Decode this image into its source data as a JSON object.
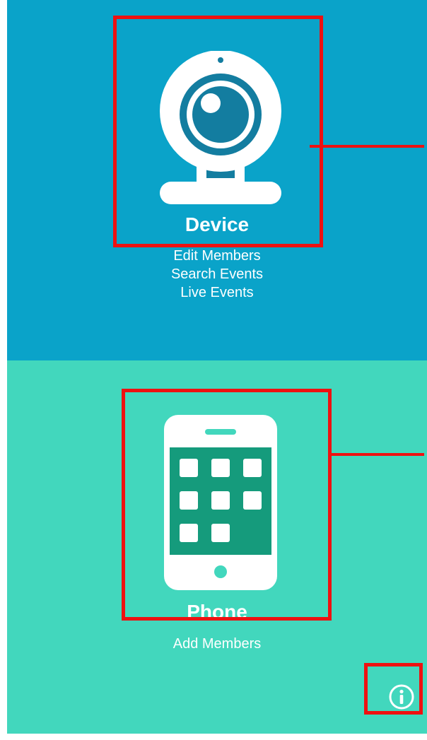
{
  "device": {
    "title": "Device",
    "menu": [
      "Edit Members",
      "Search Events",
      "Live Events"
    ],
    "icon": "webcam-icon"
  },
  "phone": {
    "title": "Phone",
    "menu": [
      "Add Members"
    ],
    "icon": "smartphone-icon"
  },
  "info_icon": "info-icon",
  "colors": {
    "device_bg": "#0aa3c9",
    "phone_bg": "#42d7bd",
    "highlight": "#ee1111",
    "phone_screen": "#159b7c",
    "webcam_dark": "#137da0"
  }
}
